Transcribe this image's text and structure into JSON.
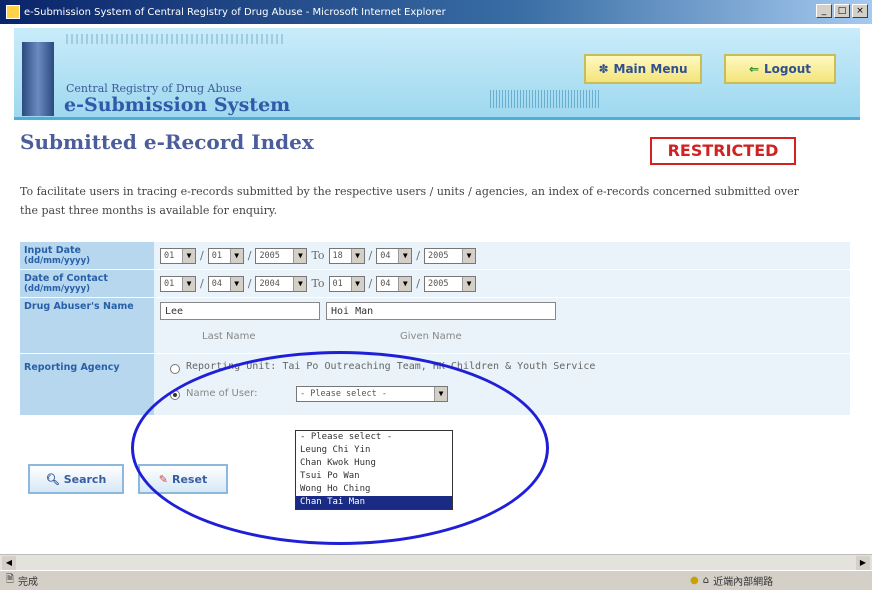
{
  "window": {
    "title": "e-Submission System of Central Registry of Drug Abuse - Microsoft Internet Explorer"
  },
  "header": {
    "subtitle": "Central Registry of Drug Abuse",
    "title": "e-Submission System",
    "main_menu": "Main Menu",
    "logout": "Logout"
  },
  "page": {
    "title": "Submitted e-Record Index",
    "restricted": "RESTRICTED",
    "intro": "To facilitate users in tracing e-records submitted by the respective users / units / agencies, an index of e-records concerned submitted over the past three months is available for enquiry."
  },
  "form": {
    "input_date": {
      "label": "Input Date",
      "hint": "(dd/mm/yyyy)",
      "from": [
        "01",
        "01",
        "2005"
      ],
      "to_label": "To",
      "to": [
        "18",
        "04",
        "2005"
      ]
    },
    "contact_date": {
      "label": "Date of Contact",
      "hint": "(dd/mm/yyyy)",
      "from": [
        "01",
        "04",
        "2004"
      ],
      "to_label": "To",
      "to": [
        "01",
        "04",
        "2005"
      ]
    },
    "name": {
      "label": "Drug Abuser's Name",
      "last_value": "Lee",
      "given_value": "Hoi Man",
      "last_label": "Last Name",
      "given_label": "Given Name"
    },
    "agency": {
      "label": "Reporting Agency",
      "unit_option": "Reporting Unit: Tai Po Outreaching Team, HK Children & Youth Service",
      "user_option": "Name of User:",
      "user_select": "- Please select -"
    }
  },
  "dropdown": {
    "options": [
      "- Please select -",
      "Leung Chi Yin",
      "Chan Kwok Hung",
      "Tsui Po Wan",
      "Wong Ho Ching",
      "Chan Tai Man"
    ],
    "highlighted": "Chan Tai Man"
  },
  "actions": {
    "search": "Search",
    "reset": "Reset"
  },
  "status": {
    "left": "完成",
    "zone": "近端內部網路"
  },
  "colors": {
    "annotation": "#1f1fd8",
    "restricted": "#cf2323"
  }
}
